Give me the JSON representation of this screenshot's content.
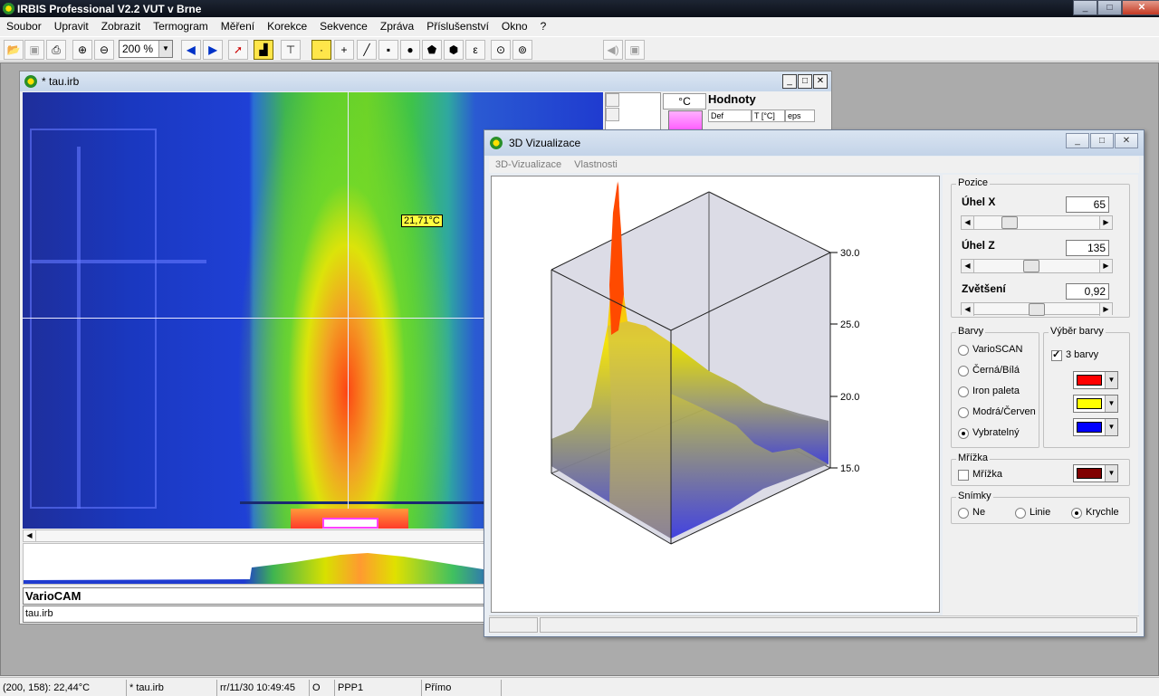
{
  "app": {
    "title": "IRBIS Professional V2.2   VUT v Brne",
    "caption_min": "_",
    "caption_max": "□",
    "caption_close": "✕"
  },
  "menu": [
    "Soubor",
    "Upravit",
    "Zobrazit",
    "Termogram",
    "Měření",
    "Korekce",
    "Sekvence",
    "Zpráva",
    "Příslušenství",
    "Okno",
    "?"
  ],
  "toolbar": {
    "zoom_value": "200 %",
    "epsilon_glyph": "ε"
  },
  "irb_window": {
    "title": "* tau.irb",
    "temp_marker": "21,71°C",
    "unit": "°C",
    "values_title": "Hodnoty",
    "values_headers": [
      "Def",
      "T [°C]",
      "eps"
    ],
    "camera": "VarioCAM",
    "file": "tau.irb"
  },
  "dialog": {
    "title": "3D Vizualizace",
    "menu": [
      "3D-Vizualizace",
      "Vlastnosti"
    ],
    "pozice": {
      "label": "Pozice",
      "uhel_x_label": "Úhel X",
      "uhel_x_value": "65",
      "uhel_z_label": "Úhel Z",
      "uhel_z_value": "135",
      "zvetseni_label": "Zvětšení",
      "zvetseni_value": "0,92",
      "slider_x": 0.25,
      "slider_z": 0.45,
      "slider_zoom": 0.5
    },
    "barvy": {
      "label": "Barvy",
      "options": [
        "VarioSCAN",
        "Černá/Bílá",
        "Iron paleta",
        "Modrá/Červen",
        "Vybratelný"
      ],
      "selected_index": 4
    },
    "vyber_barvy": {
      "label": "Výběr barvy",
      "three_colors_label": "3 barvy",
      "colors": [
        "#ff0000",
        "#ffff00",
        "#0000ff"
      ]
    },
    "mrizka": {
      "label": "Mřížka",
      "checkbox_label": "Mřížka",
      "color": "#800000"
    },
    "snimky": {
      "label": "Snímky",
      "options": [
        "Ne",
        "Linie",
        "Krychle"
      ],
      "selected_index": 2
    },
    "axis_ticks": [
      "30.0",
      "25.0",
      "20.0",
      "15.0"
    ]
  },
  "chart_data": {
    "type": "surface-3d",
    "zlim": [
      15.0,
      30.0
    ],
    "z_ticks": [
      15.0,
      20.0,
      25.0,
      30.0
    ]
  },
  "statusbar": {
    "coords": "(200, 158): 22,44°C",
    "file": "* tau.irb",
    "datetime": "rr/11/30 10:49:45",
    "flag": "O",
    "mode": "PPP1",
    "type": "Přímo"
  }
}
